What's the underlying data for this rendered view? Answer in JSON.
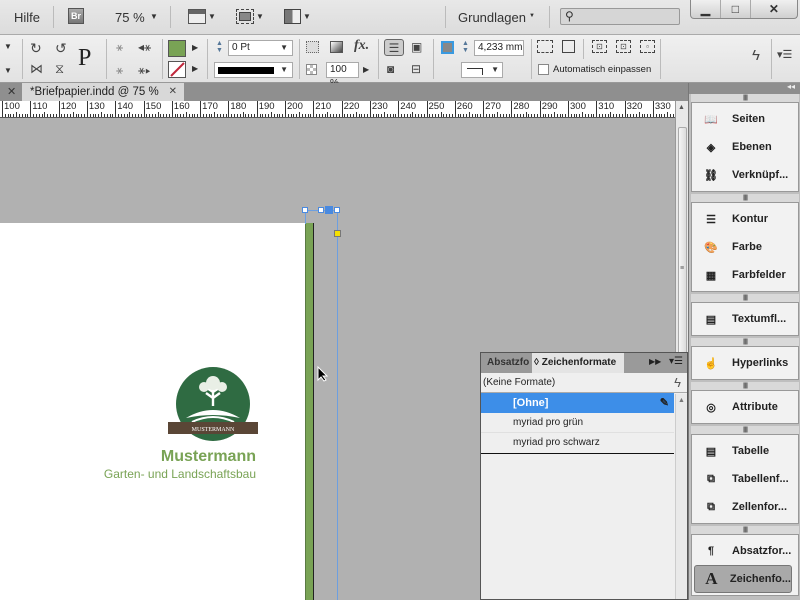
{
  "menubar": {
    "help_label": "Hilfe",
    "bridge_label": "Br",
    "zoom_value": "75 %",
    "workspace_label": "Grundlagen",
    "search_placeholder": ""
  },
  "window_controls": {
    "minimize": "▁",
    "maximize": "□",
    "close": "✕"
  },
  "control_panel": {
    "stroke_weight": "0 Pt",
    "opacity": "100 %",
    "offset_value": "4,233 mm",
    "auto_fit_label": "Automatisch einpassen",
    "fill_color": "#79a355",
    "stroke_color": "none"
  },
  "document": {
    "tab_title": "*Briefpapier.indd @ 75 %",
    "ruler_ticks": [
      "100",
      "110",
      "120",
      "130",
      "140",
      "150",
      "160",
      "170",
      "180",
      "190",
      "200",
      "210",
      "220",
      "230",
      "240",
      "250",
      "260",
      "270",
      "280",
      "290",
      "300",
      "310",
      "320",
      "330"
    ],
    "logo_banner_text": "MUSTERMANN",
    "company_name": "Mustermann",
    "company_tagline": "Garten- und Landschaftsbau",
    "brand_green": "#79a355",
    "logo_circle_color": "#2f6b42",
    "banner_color": "#5a4636"
  },
  "dock": {
    "groups": [
      {
        "items": [
          {
            "label": "Seiten",
            "icon": "pages-icon"
          },
          {
            "label": "Ebenen",
            "icon": "layers-icon"
          },
          {
            "label": "Verknüpf...",
            "icon": "links-icon"
          }
        ]
      },
      {
        "items": [
          {
            "label": "Kontur",
            "icon": "stroke-icon"
          },
          {
            "label": "Farbe",
            "icon": "color-palette-icon"
          },
          {
            "label": "Farbfelder",
            "icon": "swatches-icon"
          }
        ]
      },
      {
        "items": [
          {
            "label": "Textumfl...",
            "icon": "text-wrap-icon"
          }
        ]
      },
      {
        "items": [
          {
            "label": "Hyperlinks",
            "icon": "hyperlinks-icon"
          }
        ]
      },
      {
        "items": [
          {
            "label": "Attribute",
            "icon": "attributes-icon"
          }
        ]
      },
      {
        "items": [
          {
            "label": "Tabelle",
            "icon": "table-icon"
          },
          {
            "label": "Tabellenf...",
            "icon": "table-styles-icon"
          },
          {
            "label": "Zellenfor...",
            "icon": "cell-styles-icon"
          }
        ]
      },
      {
        "items": [
          {
            "label": "Absatzfor...",
            "icon": "paragraph-styles-icon"
          },
          {
            "label": "Zeichenfo...",
            "icon": "character-styles-icon",
            "active": true
          }
        ]
      }
    ]
  },
  "char_styles_panel": {
    "tab_inactive": "Absatzfo",
    "tab_active": "Zeichenformate",
    "current_style": "(Keine Formate)",
    "styles": [
      {
        "label": "[Ohne]",
        "selected": true
      },
      {
        "label": "myriad pro grün",
        "selected": false
      },
      {
        "label": "myriad pro schwarz",
        "selected": false
      }
    ],
    "selected_color": "#3d8ee8"
  }
}
